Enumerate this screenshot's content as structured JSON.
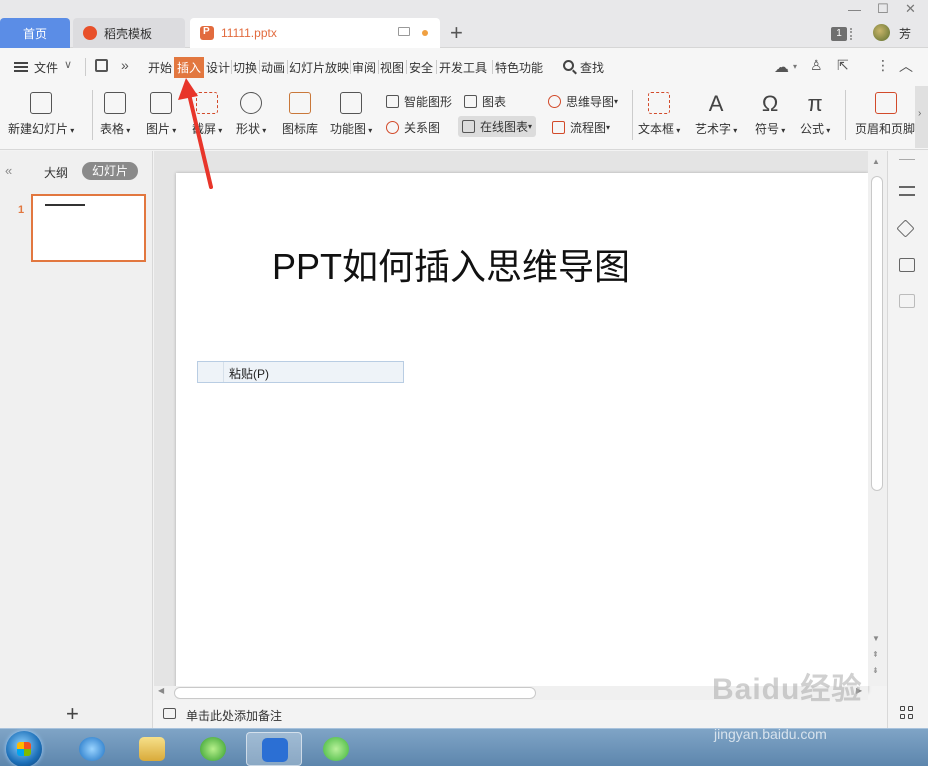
{
  "titlebar": {
    "tabs": [
      {
        "label": "首页"
      },
      {
        "label": "稻壳模板"
      },
      {
        "label": "11111.pptx"
      }
    ],
    "add_tab": "+",
    "window_count": "1",
    "user_name": "芳"
  },
  "menubar": {
    "file_label": "文件",
    "more_label": "»",
    "items": [
      "开始",
      "插入",
      "设计",
      "切换",
      "动画",
      "幻灯片放映",
      "审阅",
      "视图",
      "安全",
      "开发工具",
      "特色功能"
    ],
    "active_item": "插入",
    "search_label": "查找"
  },
  "ribbon": {
    "new_slide": "新建幻灯片",
    "table": "表格",
    "picture": "图片",
    "screenshot": "截屏",
    "shape": "形状",
    "icon_library": "图标库",
    "function_chart": "功能图",
    "smart_graphic": "智能图形",
    "chart": "图表",
    "relation_chart": "关系图",
    "online_chart": "在线图表",
    "mind_map": "思维导图",
    "flow_chart": "流程图",
    "textbox": "文本框",
    "art_text": "艺术字",
    "symbol": "符号",
    "formula": "公式",
    "header_footer": "页眉和页脚",
    "formula_glyph": "π",
    "symbol_glyph": "Ω",
    "art_glyph": "A"
  },
  "left_pane": {
    "collapse": "«",
    "tab_outline": "大纲",
    "tab_slides": "幻灯片",
    "slide_number": "1",
    "add_slide": "+"
  },
  "slide": {
    "title": "PPT如何插入思维导图"
  },
  "context_menu": {
    "paste_label": "粘贴(P)"
  },
  "notes": {
    "placeholder": "单击此处添加备注"
  },
  "watermark": {
    "brand": "Baidu经验",
    "site": "jingyan.baidu.com"
  },
  "colors": {
    "accent": "#e2773f",
    "home_tab": "#5b8de6",
    "arrow": "#e8352a"
  }
}
